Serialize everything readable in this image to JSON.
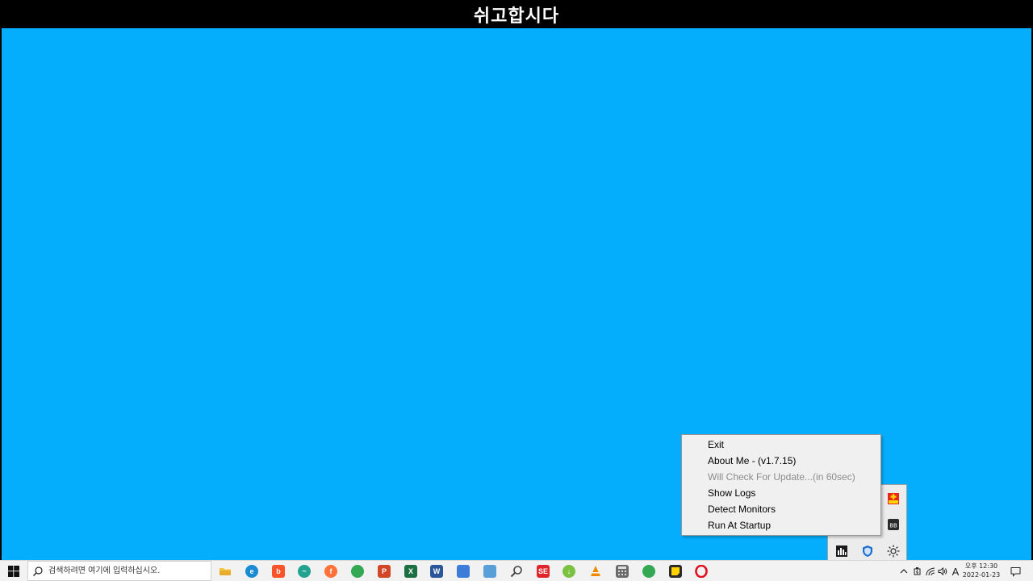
{
  "banner": {
    "title": "쉬고합시다"
  },
  "context_menu": {
    "items": [
      {
        "label": "Exit",
        "enabled": true
      },
      {
        "label": "About Me - (v1.7.15)",
        "enabled": true
      },
      {
        "label": "Will Check For Update...(in 60sec)",
        "enabled": false
      },
      {
        "label": "Show Logs",
        "enabled": true
      },
      {
        "label": "Detect Monitors",
        "enabled": true
      },
      {
        "label": "Run At Startup",
        "enabled": true
      }
    ]
  },
  "tray_overflow": {
    "icons": [
      "plus-cup-icon",
      "bb-app-icon",
      "resource-monitor-icon",
      "defender-shield-icon",
      "brightness-icon"
    ]
  },
  "taskbar": {
    "search_placeholder": "검색하려면 여기에 입력하십시오.",
    "apps": [
      {
        "name": "file-explorer",
        "icon": "folder-icon",
        "color": "#f5c542"
      },
      {
        "name": "edge",
        "icon": "edge-icon",
        "color": "#1a8ad4"
      },
      {
        "name": "brave",
        "icon": "brave-icon",
        "color": "#fb542b"
      },
      {
        "name": "edge-alt",
        "icon": "swirl-icon",
        "color": "#22a38f"
      },
      {
        "name": "firefox",
        "icon": "firefox-icon",
        "color": "#ff7139"
      },
      {
        "name": "chrome",
        "icon": "chrome-icon",
        "color": "#34a853"
      },
      {
        "name": "powerpoint",
        "icon": "powerpoint-icon",
        "color": "#d24726"
      },
      {
        "name": "excel",
        "icon": "excel-icon",
        "color": "#1d6f42"
      },
      {
        "name": "word",
        "icon": "word-icon",
        "color": "#2b579a"
      },
      {
        "name": "app-blue",
        "icon": "window-app-icon",
        "color": "#3b7dd8"
      },
      {
        "name": "remote-desktop",
        "icon": "remote-desktop-icon",
        "color": "#5aa0d8"
      },
      {
        "name": "search-tool",
        "icon": "magnifier-tool-icon",
        "color": "#555555"
      },
      {
        "name": "se-app",
        "icon": "se-app-icon",
        "color": "#e0252b"
      },
      {
        "name": "download-app",
        "icon": "download-app-icon",
        "color": "#7cc242"
      },
      {
        "name": "vlc",
        "icon": "vlc-icon",
        "color": "#f08a00"
      },
      {
        "name": "calculator",
        "icon": "calculator-icon",
        "color": "#6b6b6b"
      },
      {
        "name": "chrome-alt",
        "icon": "chrome-alt-icon",
        "color": "#34a853"
      },
      {
        "name": "sticky-notes",
        "icon": "sticky-notes-icon",
        "color": "#2b2b2b"
      },
      {
        "name": "opera",
        "icon": "opera-icon",
        "color": "#e0101e"
      }
    ],
    "system": {
      "ime": "A",
      "time": "오후 12:30",
      "date": "2022-01-23"
    }
  },
  "colors": {
    "desktop": "#05aefc",
    "taskbar": "#f2f2f2"
  }
}
